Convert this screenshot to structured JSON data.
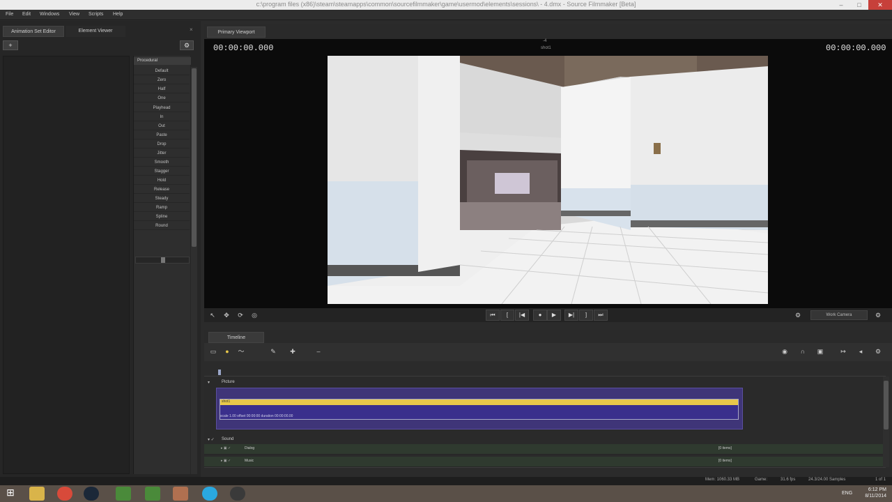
{
  "window": {
    "title": "c:\\program files (x86)\\steam\\steamapps\\common\\sourcefilmmaker\\game\\usermod\\elements\\sessions\\ - 4.dmx - Source Filmmaker [Beta]",
    "controls": {
      "minimize": "–",
      "maximize": "□",
      "close": "✕"
    }
  },
  "menu": [
    "File",
    "Edit",
    "Windows",
    "View",
    "Scripts",
    "Help"
  ],
  "left_panel": {
    "tabs": [
      "Animation Set Editor",
      "Element Viewer"
    ],
    "add_button": "+",
    "procedural": {
      "header": "Procedural",
      "items": [
        "Default",
        "Zero",
        "Half",
        "One",
        "Playhead",
        "In",
        "Out",
        "Paste",
        "Drop",
        "Jitter",
        "Smooth",
        "Stagger",
        "Hold",
        "Release",
        "Steady",
        "Ramp",
        "Spline",
        "Round"
      ]
    }
  },
  "viewport": {
    "tab": "Primary Viewport",
    "left_timecode": "00:00:00.000",
    "right_timecode": "00:00:00.000",
    "center_frame": "-4",
    "center_shot": "shot1",
    "camera_button": "Work Camera"
  },
  "transport": {
    "buttons": [
      "⏮",
      "[",
      "|◀",
      "●",
      "▶",
      "▶|",
      "]",
      "⏭"
    ]
  },
  "timeline": {
    "tab": "Timeline",
    "picture_label": "Picture",
    "shot_name": "shot1",
    "shot_info": "scale 1.00  offset  00:00:00  duration  00:00:00.00",
    "sound_label": "Sound",
    "tracks": [
      {
        "name": "Dialog",
        "items": "[0 items]"
      },
      {
        "name": "Music",
        "items": "[0 items]"
      }
    ]
  },
  "statusbar": {
    "memory": "Mem:  1060.33 MB",
    "game": "Game:",
    "fps": "31.6 fps",
    "samples": "24.3/24.00 Samples",
    "page": "1 of 1"
  },
  "taskbar": {
    "lang": "ENG",
    "time": "6:12 PM",
    "date": "8/11/2014"
  },
  "colors": {
    "accent_shot": "#e8c84a",
    "clip_bg": "#3a2f8c",
    "track_bg": "#3f3578"
  }
}
